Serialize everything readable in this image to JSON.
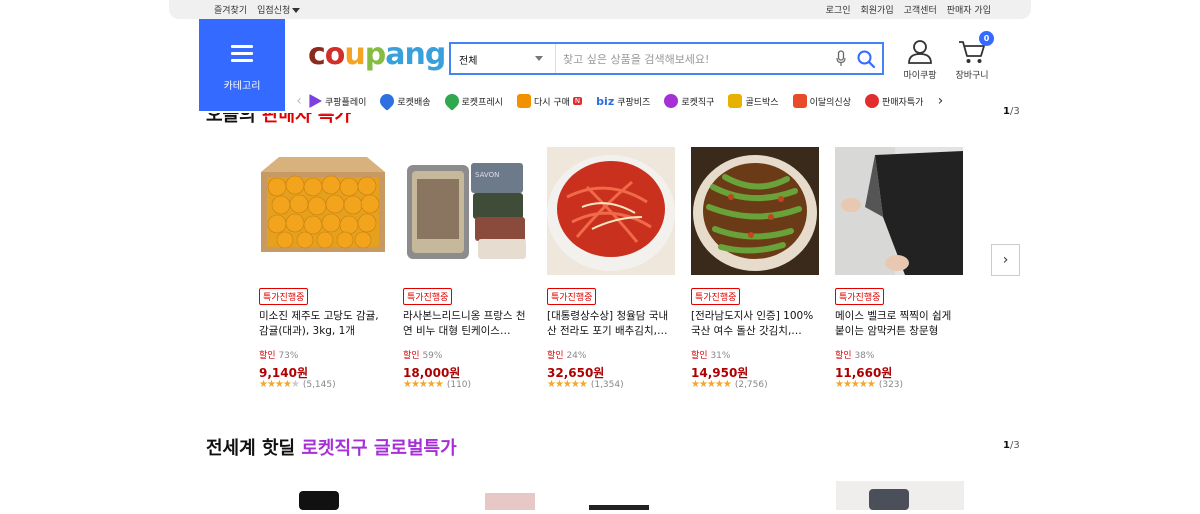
{
  "topbar": {
    "left": [
      "즐겨찾기",
      "입점신청"
    ],
    "right": [
      "로그인",
      "회원가입",
      "고객센터",
      "판매자 가입"
    ]
  },
  "category_button": {
    "label": "카테고리"
  },
  "logo": {
    "parts": [
      "c",
      "o",
      "u",
      "p",
      "ang"
    ]
  },
  "search": {
    "category": "전체",
    "placeholder": "찾고 싶은 상품을 검색해보세요!"
  },
  "account": {
    "mycoupang": "마이쿠팡",
    "cart": "장바구니",
    "cart_count": "0"
  },
  "quick_menu": [
    {
      "label": "쿠팡플레이",
      "color": "#7b3fe4"
    },
    {
      "label": "로켓배송",
      "color": "#2f6fe0"
    },
    {
      "label": "로켓프레시",
      "color": "#2fa84f"
    },
    {
      "label": "다시 구매",
      "color": "#f29100"
    },
    {
      "label": "쿠팡비즈",
      "color": "#2a6ee0"
    },
    {
      "label": "로켓직구",
      "color": "#a531d6"
    },
    {
      "label": "골드박스",
      "color": "#e7b100"
    },
    {
      "label": "이달의신상",
      "color": "#e84a2a"
    },
    {
      "label": "판매자특가",
      "color": "#e12d2d"
    }
  ],
  "section1": {
    "title_black": "오늘의 ",
    "title_accent": "판매자 특가",
    "page_current": "1",
    "page_total": "/3"
  },
  "products": [
    {
      "tag": "특가진행중",
      "name": "미소진 제주도 고당도 감귤, 감귤(대과), 3kg, 1개",
      "discount_label": "할인",
      "discount": "73%",
      "price": "9,140원",
      "rating": 4,
      "reviews": "(5,145)"
    },
    {
      "tag": "특가진행중",
      "name": "라사본느리드니옹 프랑스 천연 비누 대형 틴케이스…",
      "discount_label": "할인",
      "discount": "59%",
      "price": "18,000원",
      "rating": 4.5,
      "reviews": "(110)"
    },
    {
      "tag": "특가진행중",
      "name": "[대통령상수상] 청율담 국내산 전라도 포기 배추김치,…",
      "discount_label": "할인",
      "discount": "24%",
      "price": "32,650원",
      "rating": 4.5,
      "reviews": "(1,354)"
    },
    {
      "tag": "특가진행중",
      "name": "[전라남도지사 인증] 100% 국산 여수 돌산 갓김치,…",
      "discount_label": "할인",
      "discount": "31%",
      "price": "14,950원",
      "rating": 4.5,
      "reviews": "(2,756)"
    },
    {
      "tag": "특가진행중",
      "name": "메이스 벨크로 찍찍이 쉽게 붙이는 암막커튼 창문형",
      "discount_label": "할인",
      "discount": "38%",
      "price": "11,660원",
      "rating": 4.5,
      "reviews": "(323)"
    }
  ],
  "section2": {
    "title_black": "전세계 핫딜 ",
    "title_accent": "로켓직구 글로벌특가",
    "page_current": "1",
    "page_total": "/3"
  }
}
